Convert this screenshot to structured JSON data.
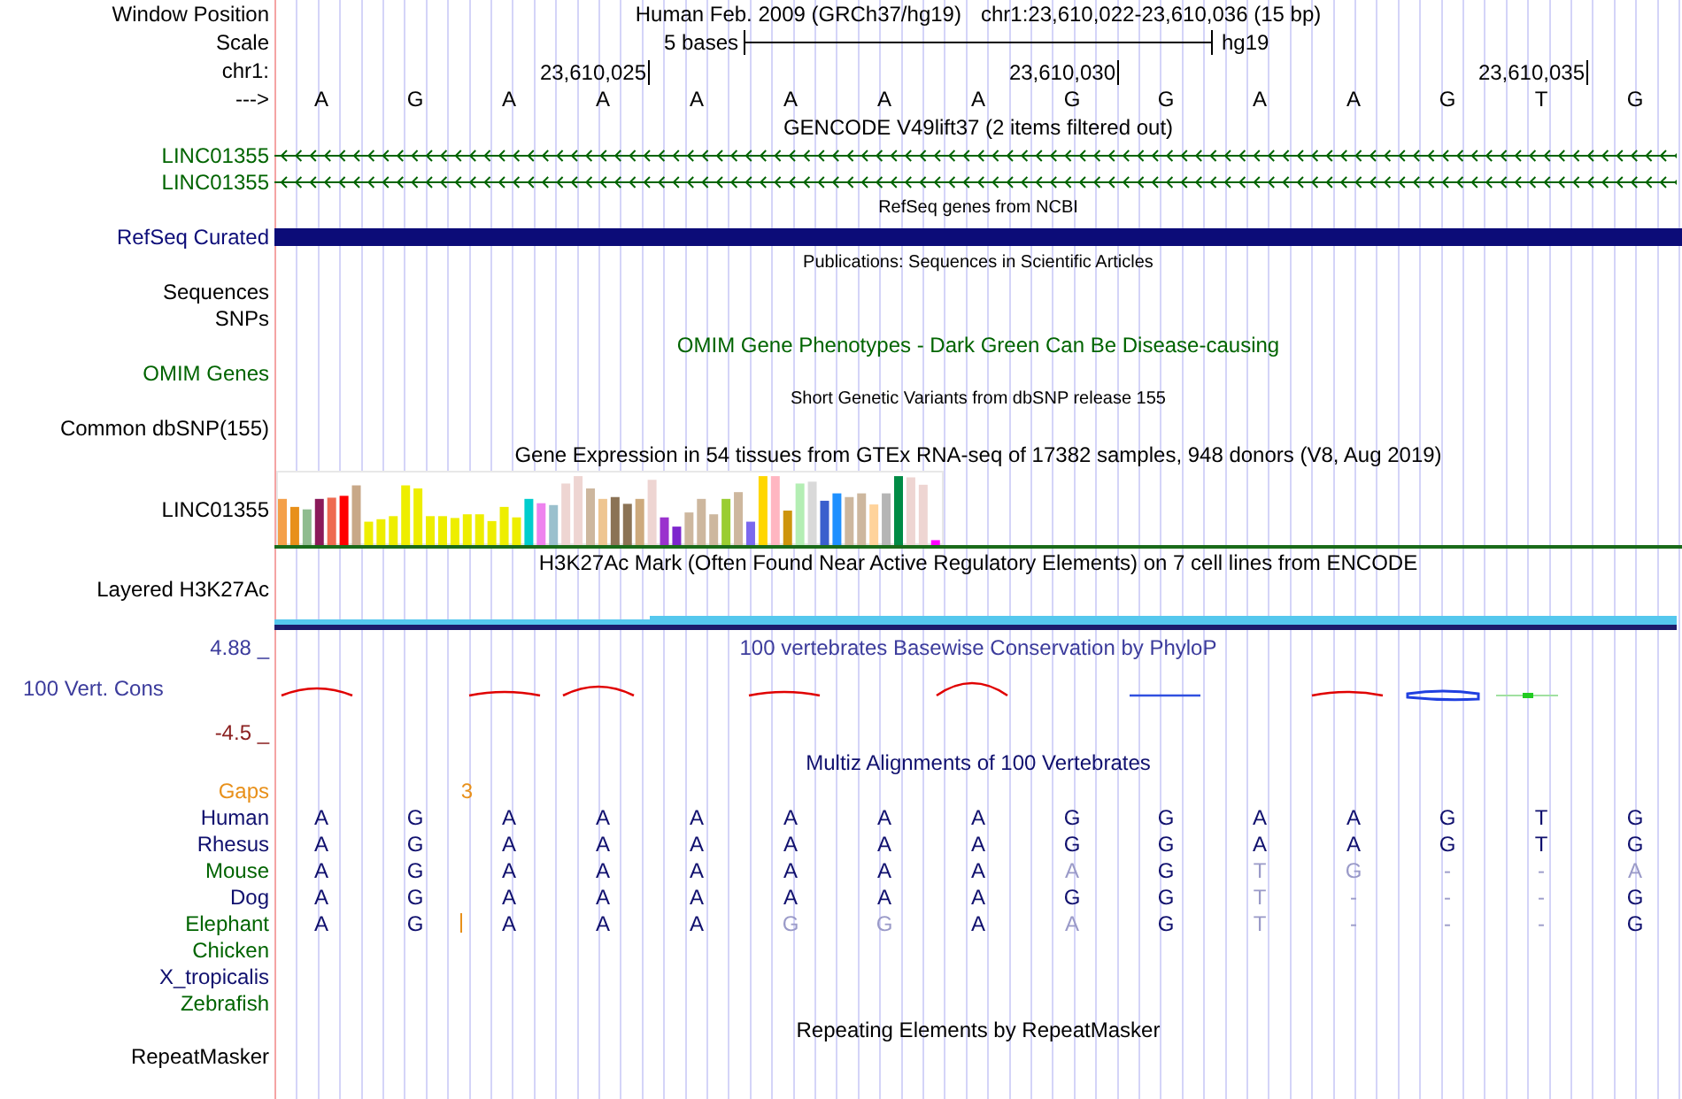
{
  "header": {
    "label": "Window Position",
    "title": "Human Feb. 2009 (GRCh37/hg19)",
    "position": "chr1:23,610,022-23,610,036 (15 bp)"
  },
  "scale": {
    "label": "Scale",
    "bar_label": "5 bases",
    "assembly": "hg19"
  },
  "ruler": {
    "label": "chr1:"
  },
  "sequence": {
    "label": "--->",
    "bases": [
      {
        "base": "A"
      },
      {
        "base": "G"
      },
      {
        "base": "A"
      },
      {
        "base": "A",
        "tick": "23,610,025"
      },
      {
        "base": "A"
      },
      {
        "base": "A"
      },
      {
        "base": "A"
      },
      {
        "base": "A"
      },
      {
        "base": "G",
        "tick": "23,610,030"
      },
      {
        "base": "G"
      },
      {
        "base": "A"
      },
      {
        "base": "A"
      },
      {
        "base": "G"
      },
      {
        "base": "T",
        "tick": "23,610,035"
      },
      {
        "base": "G"
      }
    ]
  },
  "tracks": [
    {
      "kind": "title",
      "text": "GENCODE V49lift37 (2 items filtered out)",
      "color": "#000000"
    },
    {
      "kind": "gene",
      "label": "LINC01355",
      "color": "#006400"
    },
    {
      "kind": "gene",
      "label": "LINC01355",
      "color": "#006400"
    },
    {
      "kind": "small_title",
      "text": "RefSeq genes from NCBI",
      "color": "#000000"
    },
    {
      "kind": "bar",
      "label": "RefSeq Curated",
      "color": "#0c0c78"
    },
    {
      "kind": "small_title",
      "text": "Publications: Sequences in Scientific Articles",
      "color": "#000000"
    },
    {
      "kind": "label",
      "label": "Sequences",
      "color": "#000000"
    },
    {
      "kind": "label",
      "label": "SNPs",
      "color": "#000000"
    },
    {
      "kind": "title",
      "text": "OMIM Gene Phenotypes - Dark Green Can Be Disease-causing",
      "color": "#006400"
    },
    {
      "kind": "label",
      "label": "OMIM Genes",
      "color": "#006400"
    },
    {
      "kind": "small_title",
      "text": "Short Genetic Variants from dbSNP release 155",
      "color": "#000000"
    },
    {
      "kind": "label",
      "label": "Common dbSNP(155)",
      "color": "#000000"
    },
    {
      "kind": "title",
      "text": "Gene Expression in 54 tissues from GTEx RNA-seq of 17382 samples, 948 donors (V8, Aug 2019)",
      "color": "#000000"
    },
    {
      "kind": "expression",
      "label": "LINC01355",
      "color": "#000000"
    },
    {
      "kind": "title",
      "text": "H3K27Ac Mark (Often Found Near Active Regulatory Elements) on 7 cell lines from ENCODE",
      "color": "#000000"
    },
    {
      "kind": "signal",
      "label": "Layered H3K27Ac",
      "color": "#000000"
    },
    {
      "kind": "conservation",
      "text": "100 vertebrates Basewise Conservation by PhyloP",
      "label": "100 Vert. Cons",
      "max": "4.88 _",
      "min": "-4.5 _",
      "color": "#3c3c9c"
    },
    {
      "kind": "title",
      "text": "Multiz Alignments of 100 Vertebrates",
      "color": "#10106e"
    }
  ],
  "gaps": {
    "label": "Gaps",
    "count": "3"
  },
  "alignments": [
    {
      "species": "Human",
      "color": "#10106e",
      "bases": [
        {
          "base": "A",
          "faded": false
        },
        {
          "base": "G",
          "faded": false
        },
        {
          "base": "A",
          "faded": false
        },
        {
          "base": "A",
          "faded": false
        },
        {
          "base": "A",
          "faded": false
        },
        {
          "base": "A",
          "faded": false
        },
        {
          "base": "A",
          "faded": false
        },
        {
          "base": "A",
          "faded": false
        },
        {
          "base": "G",
          "faded": false
        },
        {
          "base": "G",
          "faded": false
        },
        {
          "base": "A",
          "faded": false
        },
        {
          "base": "A",
          "faded": false
        },
        {
          "base": "G",
          "faded": false
        },
        {
          "base": "T",
          "faded": false
        },
        {
          "base": "G",
          "faded": false
        }
      ]
    },
    {
      "species": "Rhesus",
      "color": "#10106e",
      "bases": [
        {
          "base": "A",
          "faded": false
        },
        {
          "base": "G",
          "faded": false
        },
        {
          "base": "A",
          "faded": false
        },
        {
          "base": "A",
          "faded": false
        },
        {
          "base": "A",
          "faded": false
        },
        {
          "base": "A",
          "faded": false
        },
        {
          "base": "A",
          "faded": false
        },
        {
          "base": "A",
          "faded": false
        },
        {
          "base": "G",
          "faded": false
        },
        {
          "base": "G",
          "faded": false
        },
        {
          "base": "A",
          "faded": false
        },
        {
          "base": "A",
          "faded": false
        },
        {
          "base": "G",
          "faded": false
        },
        {
          "base": "T",
          "faded": false
        },
        {
          "base": "G",
          "faded": false
        }
      ]
    },
    {
      "species": "Mouse",
      "color": "#006400",
      "bases": [
        {
          "base": "A",
          "faded": false
        },
        {
          "base": "G",
          "faded": false
        },
        {
          "base": "A",
          "faded": false
        },
        {
          "base": "A",
          "faded": false
        },
        {
          "base": "A",
          "faded": false
        },
        {
          "base": "A",
          "faded": false
        },
        {
          "base": "A",
          "faded": false
        },
        {
          "base": "A",
          "faded": false
        },
        {
          "base": "A",
          "faded": true
        },
        {
          "base": "G",
          "faded": false
        },
        {
          "base": "T",
          "faded": true
        },
        {
          "base": "G",
          "faded": true
        },
        {
          "base": "-",
          "faded": true
        },
        {
          "base": "-",
          "faded": true
        },
        {
          "base": "A",
          "faded": true
        }
      ]
    },
    {
      "species": "Dog",
      "color": "#10106e",
      "bases": [
        {
          "base": "A",
          "faded": false
        },
        {
          "base": "G",
          "faded": false
        },
        {
          "base": "A",
          "faded": false
        },
        {
          "base": "A",
          "faded": false
        },
        {
          "base": "A",
          "faded": false
        },
        {
          "base": "A",
          "faded": false
        },
        {
          "base": "A",
          "faded": false
        },
        {
          "base": "A",
          "faded": false
        },
        {
          "base": "G",
          "faded": false
        },
        {
          "base": "G",
          "faded": false
        },
        {
          "base": "T",
          "faded": true
        },
        {
          "base": "-",
          "faded": true
        },
        {
          "base": "-",
          "faded": true
        },
        {
          "base": "-",
          "faded": true
        },
        {
          "base": "G",
          "faded": false
        }
      ]
    },
    {
      "species": "Elephant",
      "color": "#006400",
      "insertion": true,
      "bases": [
        {
          "base": "A",
          "faded": false
        },
        {
          "base": "G",
          "faded": false
        },
        {
          "base": "A",
          "faded": false
        },
        {
          "base": "A",
          "faded": false
        },
        {
          "base": "A",
          "faded": false
        },
        {
          "base": "G",
          "faded": true
        },
        {
          "base": "G",
          "faded": true
        },
        {
          "base": "A",
          "faded": false
        },
        {
          "base": "A",
          "faded": true
        },
        {
          "base": "G",
          "faded": false
        },
        {
          "base": "T",
          "faded": true
        },
        {
          "base": "-",
          "faded": true
        },
        {
          "base": "-",
          "faded": true
        },
        {
          "base": "-",
          "faded": true
        },
        {
          "base": "G",
          "faded": false
        }
      ]
    },
    {
      "species": "Chicken",
      "color": "#006400"
    },
    {
      "species": "X_tropicalis",
      "color": "#10106e"
    },
    {
      "species": "Zebrafish",
      "color": "#006400"
    }
  ],
  "repeats": {
    "title": "Repeating Elements by RepeatMasker",
    "label": "RepeatMasker"
  }
}
